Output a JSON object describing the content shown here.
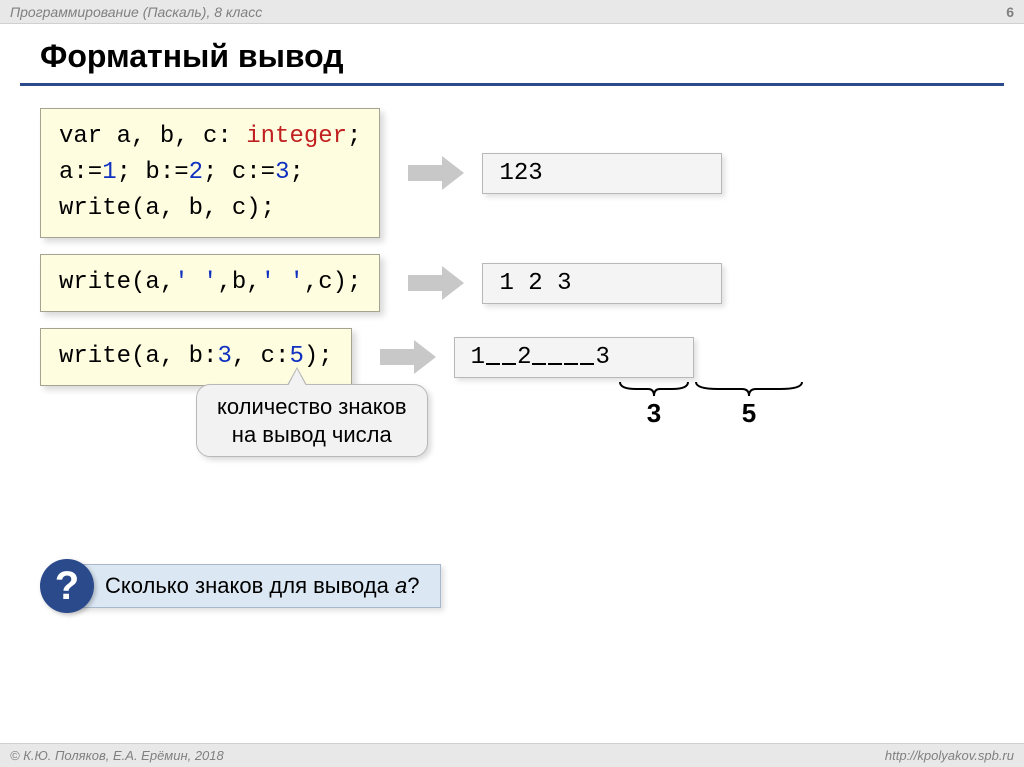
{
  "header": {
    "subject": "Программирование (Паскаль), 8 класс",
    "page_number": "6"
  },
  "title": "Форматный вывод",
  "block1": {
    "code_plain": "var a, b, c:",
    "type_kw": " integer",
    "semi": ";",
    "line2_pre": "a:=",
    "a": "1",
    "line2_mid1": "; b:=",
    "b": "2",
    "line2_mid2": "; c:=",
    "c": "3",
    "line2_end": ";",
    "line3": "write(a, b, c);",
    "output": "123"
  },
  "block2": {
    "code_pre": "write(a,",
    "sq1": "' '",
    "mid1": ",b,",
    "sq2": "' '",
    "mid2": ",c);",
    "output": "1 2 3"
  },
  "block3": {
    "code_pre": "write(a, b:",
    "n1": "3",
    "mid": ", c:",
    "n2": "5",
    "end": ");",
    "out_1": "1",
    "out_2": "2",
    "out_3": "3",
    "brace_a": "3",
    "brace_b": "5"
  },
  "callout": {
    "line1": "количество знаков",
    "line2": "на вывод числа"
  },
  "question": {
    "mark": "?",
    "text_pre": "Сколько знаков для вывода ",
    "var": "a",
    "text_post": "?"
  },
  "footer": {
    "left": "© К.Ю. Поляков, Е.А. Ерёмин, 2018",
    "right": "http://kpolyakov.spb.ru"
  }
}
